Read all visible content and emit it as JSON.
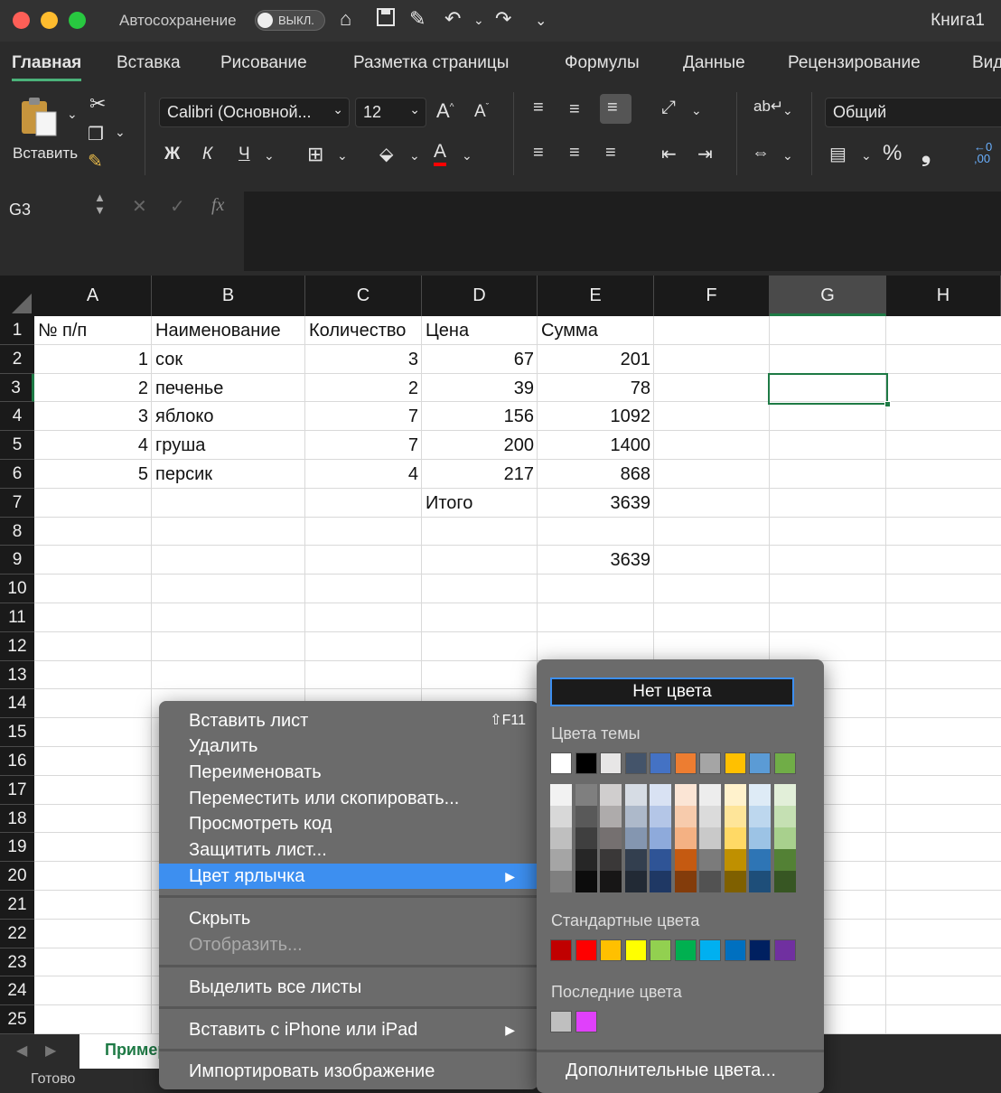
{
  "title_bar": {
    "autosave_label": "Автосохранение",
    "autosave_state": "ВЫКЛ.",
    "window_title": "Книга1"
  },
  "ribbon_tabs": [
    "Главная",
    "Вставка",
    "Рисование",
    "Разметка страницы",
    "Формулы",
    "Данные",
    "Рецензирование",
    "Вид"
  ],
  "ribbon": {
    "paste_label": "Вставить",
    "font_name": "Calibri (Основной...",
    "font_size": "12",
    "bold": "Ж",
    "italic": "К",
    "underline": "Ч",
    "font_color_letter": "A",
    "number_format": "Общий",
    "percent": "%",
    "comma": "❟",
    "font_color": "#ff0000"
  },
  "formula_bar": {
    "name_box": "G3",
    "fx": "fx"
  },
  "columns": [
    "A",
    "B",
    "C",
    "D",
    "E",
    "F",
    "G",
    "H"
  ],
  "selected_column": "G",
  "selected_cell": "G3",
  "rows": [
    "1",
    "2",
    "3",
    "4",
    "5",
    "6",
    "7",
    "8",
    "9",
    "10",
    "11",
    "12",
    "13",
    "14",
    "15",
    "16",
    "17",
    "18",
    "19",
    "20",
    "21",
    "22",
    "23",
    "24",
    "25"
  ],
  "cells": {
    "header": [
      "№ п/п",
      "Наименование",
      "Количество",
      "Цена",
      "Сумма"
    ],
    "data": [
      [
        "1",
        "сок",
        "3",
        "67",
        "201"
      ],
      [
        "2",
        "печенье",
        "2",
        "39",
        "78"
      ],
      [
        "3",
        "яблоко",
        "7",
        "156",
        "1092"
      ],
      [
        "4",
        "груша",
        "7",
        "200",
        "1400"
      ],
      [
        "5",
        "персик",
        "4",
        "217",
        "868"
      ]
    ],
    "total_label": "Итого",
    "total_value": "3639",
    "row9_value": "3639"
  },
  "sheet_tab": "Пример",
  "status": "Готово",
  "context_menu": {
    "items": [
      {
        "label": "Вставить лист",
        "shortcut": "⇧F11"
      },
      {
        "label": "Удалить"
      },
      {
        "label": "Переименовать"
      },
      {
        "label": "Переместить или скопировать..."
      },
      {
        "label": "Просмотреть код"
      },
      {
        "label": "Защитить лист..."
      },
      {
        "label": "Цвет ярлычка",
        "submenu": "▶"
      },
      {
        "label": "Скрыть"
      },
      {
        "label": "Отобразить..."
      },
      {
        "label": "Выделить все листы"
      },
      {
        "label": "Вставить с iPhone или iPad",
        "submenu": "▶"
      },
      {
        "label": "Импортировать изображение"
      }
    ]
  },
  "color_palette": {
    "no_color": "Нет цвета",
    "theme_label": "Цвета темы",
    "standard_label": "Стандартные цвета",
    "recent_label": "Последние цвета",
    "more_colors": "Дополнительные цвета...",
    "theme_top": [
      "#ffffff",
      "#000000",
      "#e7e6e6",
      "#44546a",
      "#4472c4",
      "#ed7d31",
      "#a5a5a5",
      "#ffc000",
      "#5b9bd5",
      "#70ad47"
    ],
    "theme_shades": [
      [
        "#f2f2f2",
        "#d8d8d8",
        "#bfbfbf",
        "#a5a5a5",
        "#7f7f7f"
      ],
      [
        "#7f7f7f",
        "#595959",
        "#3f3f3f",
        "#262626",
        "#0c0c0c"
      ],
      [
        "#d0cece",
        "#aeabab",
        "#757070",
        "#3a3838",
        "#171616"
      ],
      [
        "#d6dce4",
        "#adb9ca",
        "#8496b0",
        "#333f4f",
        "#222a35"
      ],
      [
        "#d9e2f3",
        "#b4c6e7",
        "#8eaadb",
        "#2f5496",
        "#1f3864"
      ],
      [
        "#fbe5d5",
        "#f7cbac",
        "#f4b183",
        "#c55a11",
        "#833c0b"
      ],
      [
        "#ededed",
        "#dbdbdb",
        "#c9c9c9",
        "#7b7b7b",
        "#525252"
      ],
      [
        "#fff2cc",
        "#fee599",
        "#ffd965",
        "#bf9000",
        "#7f6000"
      ],
      [
        "#deebf6",
        "#bdd7ee",
        "#9cc3e5",
        "#2e75b5",
        "#1e4e79"
      ],
      [
        "#e2efd9",
        "#c5e0b3",
        "#a8d08d",
        "#538135",
        "#375623"
      ]
    ],
    "standard": [
      "#c00000",
      "#ff0000",
      "#ffc000",
      "#ffff00",
      "#92d050",
      "#00b050",
      "#00b0f0",
      "#0070c0",
      "#002060",
      "#7030a0"
    ],
    "recent": [
      "#bfbfbf",
      "#e040fb"
    ]
  }
}
